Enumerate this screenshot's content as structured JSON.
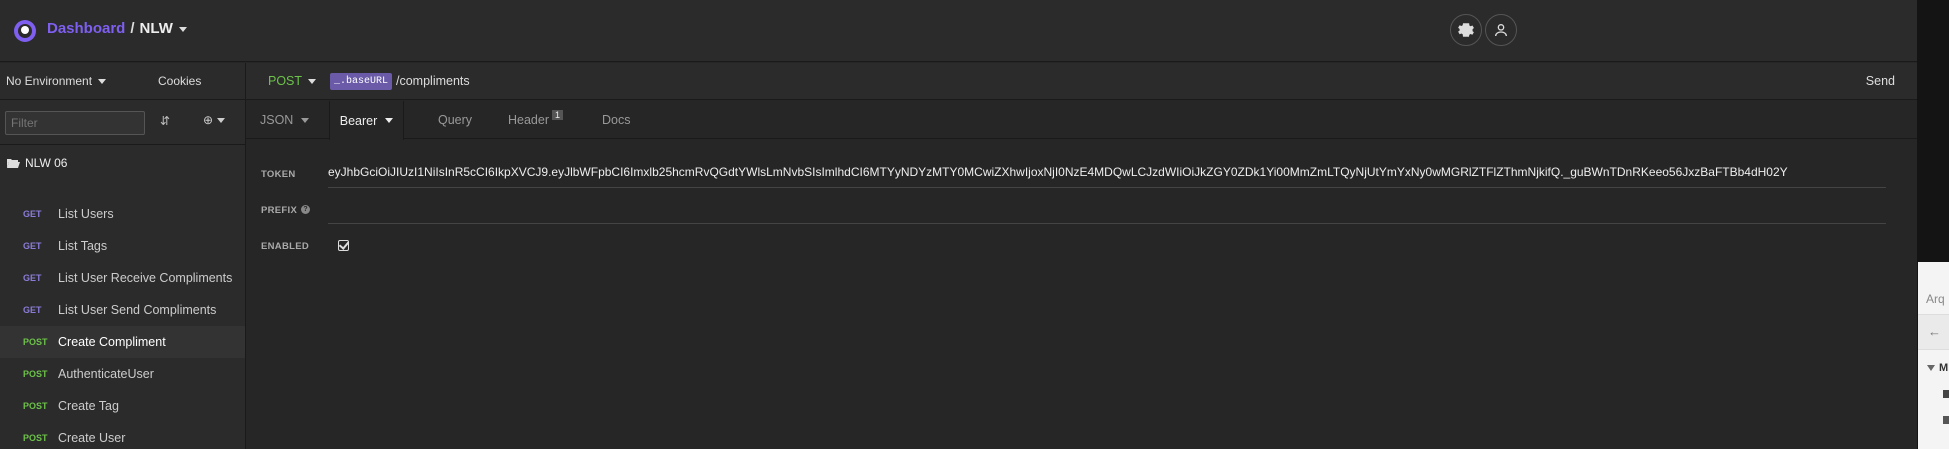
{
  "header": {
    "breadcrumb_root": "Dashboard",
    "breadcrumb_separator": "/",
    "workspace": "NLW"
  },
  "sidebar": {
    "environment": "No Environment",
    "cookies": "Cookies",
    "filter_placeholder": "Filter",
    "folder": "NLW 06",
    "requests": [
      {
        "method": "GET",
        "label": "List Users"
      },
      {
        "method": "GET",
        "label": "List Tags"
      },
      {
        "method": "GET",
        "label": "List User Receive Compliments"
      },
      {
        "method": "GET",
        "label": "List User Send Compliments"
      },
      {
        "method": "POST",
        "label": "Create Compliment",
        "active": true
      },
      {
        "method": "POST",
        "label": "AuthenticateUser"
      },
      {
        "method": "POST",
        "label": "Create Tag"
      },
      {
        "method": "POST",
        "label": "Create User"
      }
    ]
  },
  "request": {
    "method": "POST",
    "url_tag": "_.baseURL",
    "url_path": "/compliments",
    "send": "Send"
  },
  "tabs": [
    {
      "label": "JSON",
      "dropdown": true
    },
    {
      "label": "Bearer",
      "dropdown": true,
      "active": true
    },
    {
      "label": "Query"
    },
    {
      "label": "Header",
      "badge": "1"
    },
    {
      "label": "Docs"
    }
  ],
  "auth": {
    "token_label": "TOKEN",
    "token_value": "eyJhbGciOiJIUzI1NiIsInR5cCI6IkpXVCJ9.eyJlbWFpbCI6Imxlb25hcmRvQGdtYWlsLmNvbSIsImlhdCI6MTYyNDYzMTY0MCwiZXhwIjoxNjI0NzE4MDQwLCJzdWIiOiJkZGY0ZDk1Yi00MmZmLTQyNjUtYmYxNy0wMGRlZTFlZThmNjkifQ._guBWnTDnRKeeo56JxzBaFTBb4dH02Y",
    "prefix_label": "PREFIX",
    "help_icon_text": "?",
    "enabled_label": "ENABLED",
    "enabled": true
  },
  "popup": {
    "title_fragment": "Arq",
    "item_fragment": "M"
  },
  "colors": {
    "accent": "#7e5ff0",
    "get": "#8b7bd8",
    "post": "#6cc24a"
  }
}
